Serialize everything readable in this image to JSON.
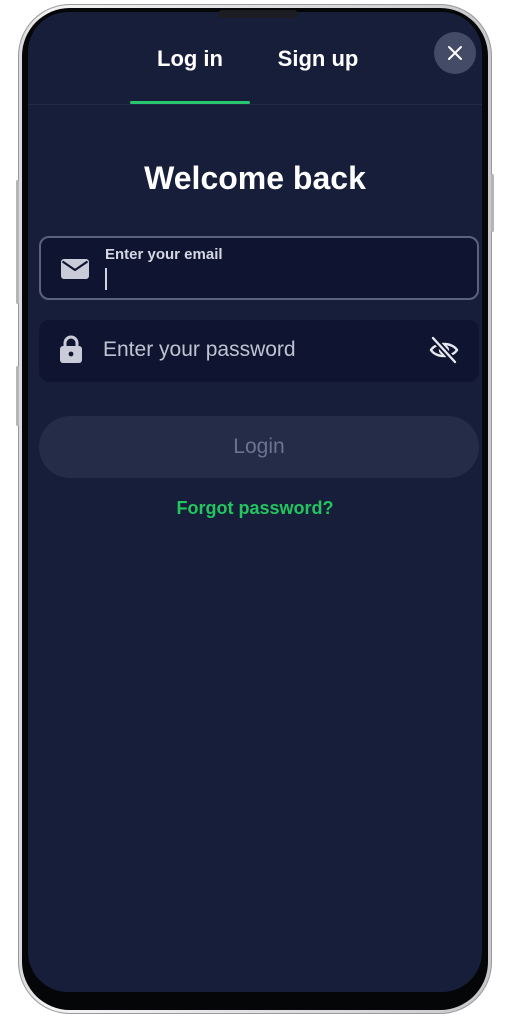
{
  "tabs": {
    "login_label": "Log in",
    "signup_label": "Sign up",
    "active": "login"
  },
  "close_icon": "close-icon",
  "title": "Welcome back",
  "email": {
    "label": "Enter your email",
    "value": "",
    "icon": "envelope-icon"
  },
  "password": {
    "placeholder": "Enter your password",
    "value": "",
    "icon": "lock-icon",
    "toggle_icon": "eye-off-icon"
  },
  "login_button": {
    "label": "Login",
    "enabled": false
  },
  "forgot_password": "Forgot password?",
  "colors": {
    "background": "#171e3a",
    "accent": "#28c76f",
    "link": "#22c55e",
    "field": "#0f1530",
    "button_disabled": "#252c48"
  }
}
